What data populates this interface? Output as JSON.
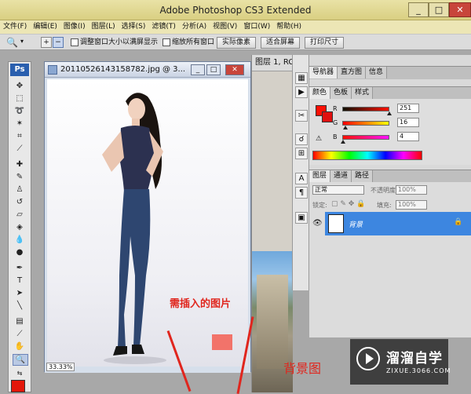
{
  "app": {
    "title": "Adobe Photoshop CS3 Extended",
    "controls": {
      "minimize": "_",
      "maximize": "□",
      "close": "✕"
    }
  },
  "menu": [
    "文件(F)",
    "编辑(E)",
    "图像(I)",
    "图层(L)",
    "选择(S)",
    "滤镜(T)",
    "分析(A)",
    "视图(V)",
    "窗口(W)",
    "帮助(H)"
  ],
  "options_bar": {
    "checkbox_fit": "调整窗口大小以满屏显示",
    "checkbox_zoom_all": "缩放所有窗口",
    "btn_actual": "实际像素",
    "btn_fit": "适合屏幕",
    "btn_print": "打印尺寸"
  },
  "toolbox": {
    "logo": "Ps"
  },
  "document": {
    "title": "20110526143158782.jpg @ 3...",
    "zoom": "33.33%"
  },
  "background_document": {
    "title": "图层 1, RC"
  },
  "panels": {
    "navigator_tabs": [
      "导航器",
      "直方图",
      "信息"
    ],
    "color_tabs": [
      "颜色",
      "色板",
      "样式"
    ],
    "color": {
      "r_label": "R",
      "g_label": "G",
      "b_label": "B",
      "r": 251,
      "g": 16,
      "b": 4,
      "fg": "#fb1004",
      "bg": "#e01010"
    },
    "layers_tabs": [
      "图层",
      "通道",
      "路径"
    ],
    "layers": {
      "blend_mode": "正常",
      "opacity_label": "不透明度:",
      "opacity": "100%",
      "lock_label": "锁定:",
      "fill_label": "填充:",
      "fill": "100%",
      "layer_name": "背景"
    }
  },
  "annotations": {
    "insert_image": "需插入的图片",
    "background_image": "背景图"
  },
  "watermark": {
    "name": "溜溜自学",
    "url": "ZIXUE.3066.COM"
  },
  "colors": {
    "accent_red": "#e0261e",
    "layer_selected": "#3d86e0",
    "titlebar": "#ddd48b"
  }
}
